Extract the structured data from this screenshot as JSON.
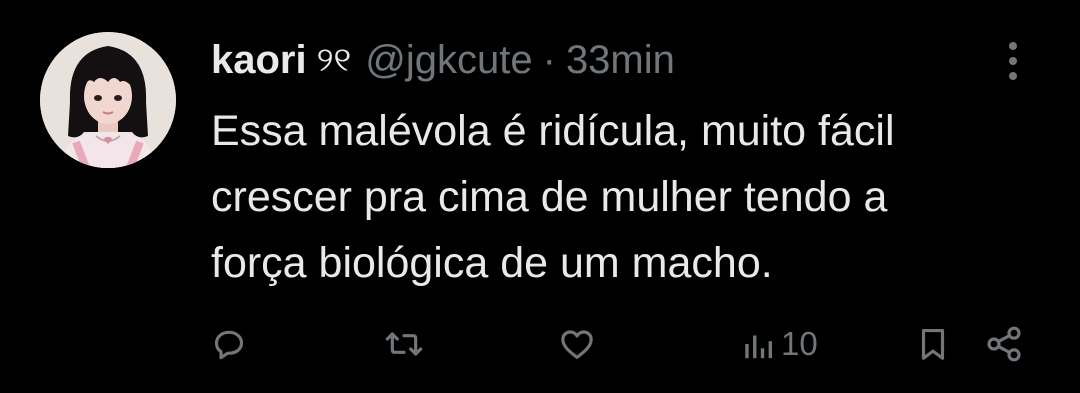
{
  "tweet": {
    "author": {
      "display_name": "kaori",
      "name_emoji": "୨୧",
      "handle": "@jgkcute"
    },
    "separator": "·",
    "timestamp": "33min",
    "text_lines": [
      "Essa malévola é ridícula, muito fácil",
      "crescer pra cima de mulher tendo a",
      "força biológica de um macho."
    ],
    "metrics": {
      "views": "10"
    },
    "icons": {
      "more": "more-vertical-icon",
      "reply": "reply-icon",
      "retweet": "retweet-icon",
      "like": "heart-icon",
      "views": "views-icon",
      "bookmark": "bookmark-icon",
      "share": "share-icon"
    }
  },
  "colors": {
    "background": "#000000",
    "primary_text": "#e7e9ea",
    "secondary_text": "#71767b"
  }
}
